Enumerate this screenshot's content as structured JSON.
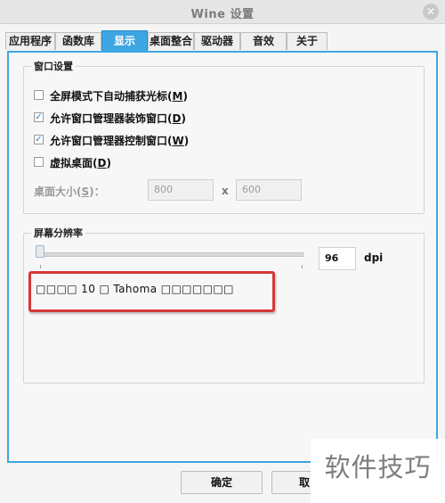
{
  "window": {
    "title": "Wine 设置"
  },
  "tabs": [
    {
      "label": "应用程序"
    },
    {
      "label": "函数库"
    },
    {
      "label": "显示"
    },
    {
      "label": "桌面整合"
    },
    {
      "label": "驱动器"
    },
    {
      "label": "音效"
    },
    {
      "label": "关于"
    }
  ],
  "window_settings": {
    "title": "窗口设置",
    "options": [
      {
        "label": "全屏模式下自动捕获光标(",
        "hotkey": "M",
        "label_end": ")",
        "checked": false
      },
      {
        "label": "允许窗口管理器装饰窗口(",
        "hotkey": "D",
        "label_end": ")",
        "checked": true
      },
      {
        "label": "允许窗口管理器控制窗口(",
        "hotkey": "W",
        "label_end": ")",
        "checked": true
      },
      {
        "label": "虚拟桌面(",
        "hotkey": "D",
        "label_end": ")",
        "checked": false
      }
    ],
    "desktop_size": {
      "label": "桌面大小(",
      "hotkey": "S",
      "label_end": ")：",
      "width": "800",
      "times": "x",
      "height": "600"
    }
  },
  "resolution": {
    "title": "屏幕分辨率",
    "dpi_value": "96",
    "dpi_unit": "dpi",
    "slider_level": 0.0,
    "sample_text": "□□□□ 10 □ Tahoma □□□□□□□"
  },
  "buttons": {
    "ok": "确定",
    "cancel": "取"
  },
  "watermark": "软件技巧",
  "colors": {
    "accent": "#3ea6e2",
    "highlight_border": "#d63737"
  }
}
